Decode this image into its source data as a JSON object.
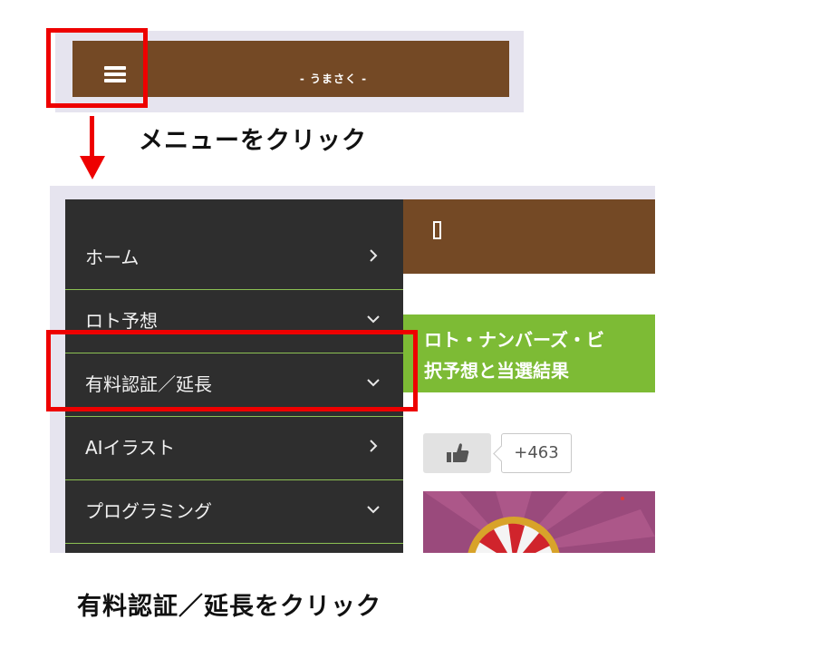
{
  "top_screenshot": {
    "site_title": "- うまさく -",
    "menu_icon": "hamburger-menu-icon"
  },
  "instructions": {
    "step1": "メニューをクリック",
    "step2": "有料認証／延長をクリック"
  },
  "drawer": {
    "items": [
      {
        "label": "ホーム",
        "icon": "chevron-right-icon"
      },
      {
        "label": "ロト予想",
        "icon": "chevron-down-icon"
      },
      {
        "label": "有料認証／延長",
        "icon": "chevron-down-icon"
      },
      {
        "label": "AIイラスト",
        "icon": "chevron-right-icon"
      },
      {
        "label": "プログラミング",
        "icon": "chevron-down-icon"
      }
    ]
  },
  "content": {
    "banner_line1": "ロト・ナンバーズ・ビ",
    "banner_line2": "択予想と当選結果",
    "like_count": "+463",
    "like_icon": "thumbs-up-icon"
  },
  "colors": {
    "header_brown": "#744925",
    "drawer_dark": "#2e2e2e",
    "divider_green": "#8cc153",
    "banner_green": "#7dbb35",
    "highlight_red": "#ee0000"
  }
}
